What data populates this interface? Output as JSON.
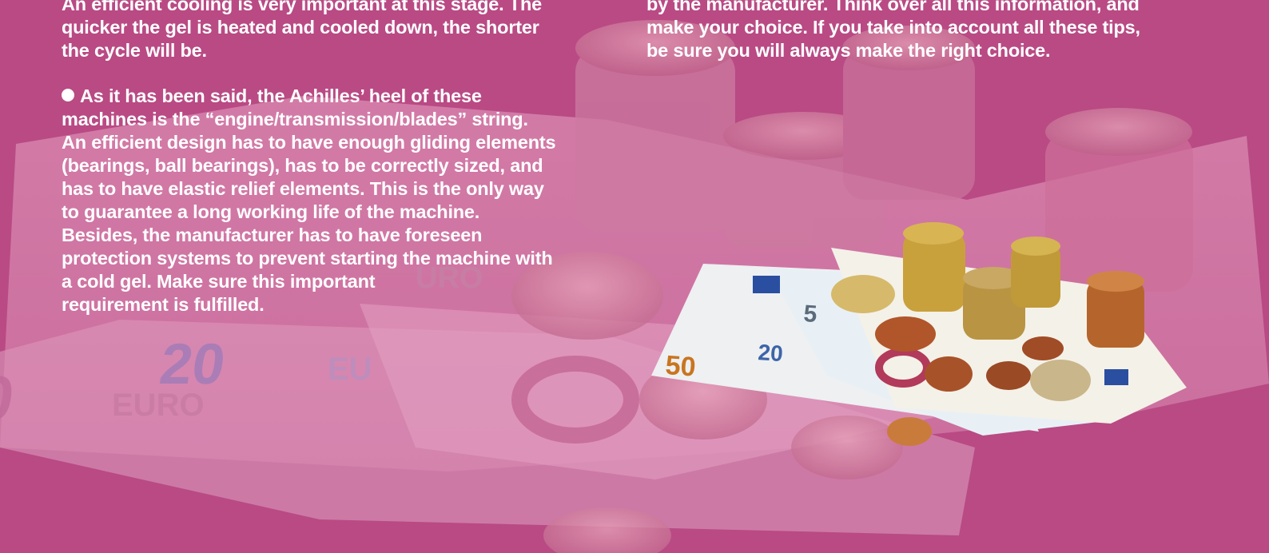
{
  "left_column": {
    "para1_lines": [
      "An efficient cooling is very important at this stage. The",
      "quicker the gel is heated and cooled down, the shorter",
      "the cycle will be."
    ],
    "para2_lines": [
      "As it has been said, the Achilles’ heel of these",
      "machines is the “engine/transmission/blades” string.",
      "An efficient design has to have enough gliding elements",
      "(bearings, ball bearings), has to be correctly sized, and",
      "has to have elastic relief elements. This is the only way",
      "to guarantee a long working life of the machine.",
      "Besides, the manufacturer has to have foreseen",
      "protection systems to prevent starting the machine with",
      "a cold gel. Make sure this important",
      "requirement is fulfilled."
    ]
  },
  "right_column": {
    "para_lines": [
      "by the manufacturer. Think over all this information, and",
      "make your choice. If you take into account all these tips,",
      "be sure you will always make the right choice."
    ]
  },
  "images": {
    "background_photo": "euro-banknotes-and-coins-tinted",
    "foreground_photo": "euro-banknotes-and-coins-stack"
  },
  "colors": {
    "background": "#b94a84",
    "text": "#ffffff"
  }
}
